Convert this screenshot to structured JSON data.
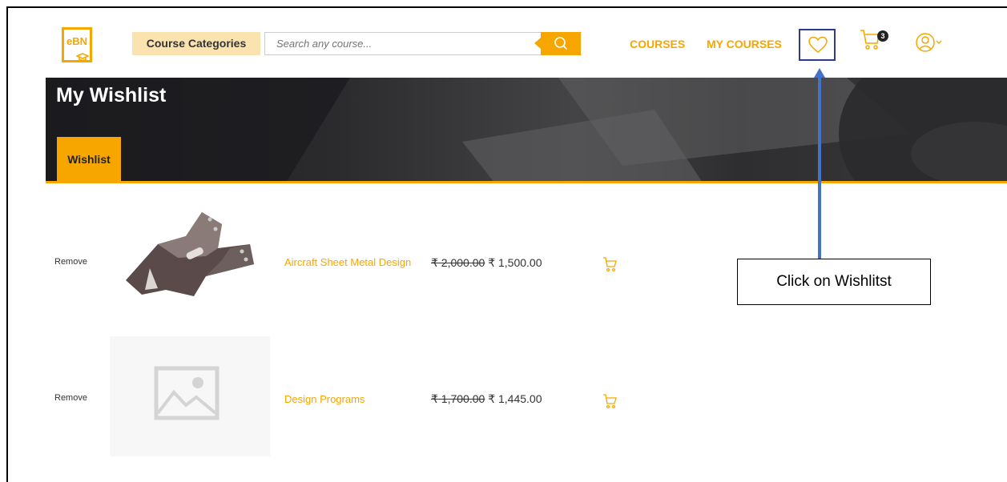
{
  "header": {
    "logo_text": "eBN",
    "categories_label": "Course Categories",
    "search_placeholder": "Search any course...",
    "nav": {
      "courses": "COURSES",
      "my_courses": "MY COURSES"
    },
    "cart_count": "3",
    "icons": [
      "search-icon",
      "heart-icon",
      "cart-icon",
      "user-icon",
      "chevron-down-icon"
    ]
  },
  "banner": {
    "title": "My Wishlist",
    "tab_label": "Wishlist"
  },
  "wishlist": [
    {
      "remove_label": "Remove",
      "title": "Aircraft Sheet Metal Design",
      "old_price": "₹ 2,000.00",
      "new_price": "₹ 1,500.00"
    },
    {
      "remove_label": "Remove",
      "title": "Design Programs",
      "old_price": "₹ 1,700.00",
      "new_price": "₹ 1,445.00"
    }
  ],
  "annotation": {
    "text": "Click on Wishlitst"
  },
  "colors": {
    "accent": "#f7a600",
    "tab_bg": "#fbe3b0",
    "highlight_box": "#2e3a8c",
    "arrow": "#4472c4"
  }
}
